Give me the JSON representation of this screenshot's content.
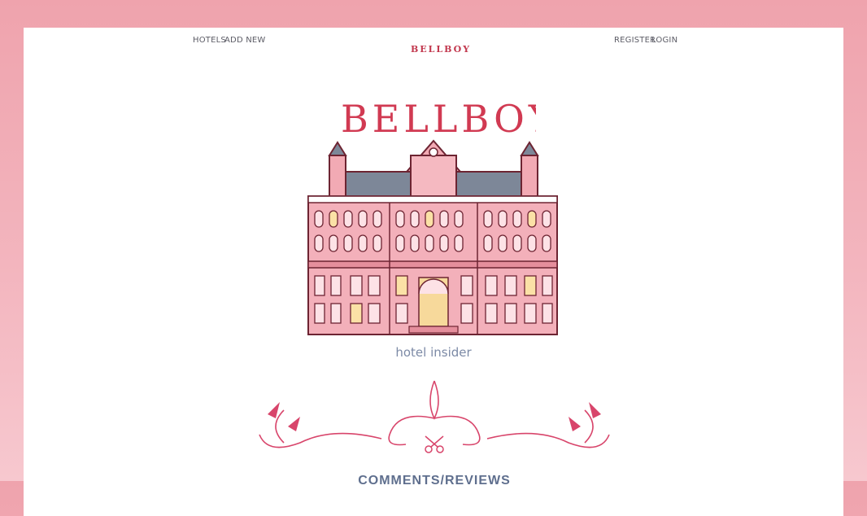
{
  "nav": {
    "hotels": "HOTELS",
    "add_new": "ADD NEW",
    "brand": "BELLBOY",
    "register": "REGISTER",
    "login": "LOGIN"
  },
  "hero": {
    "title": "BELLBOY",
    "tagline": "hotel insider"
  },
  "section": {
    "title": "COMMENTS/REVIEWS"
  },
  "colors": {
    "background": "#efa3ad",
    "brand": "#d13a52",
    "tagline": "#7c8aa6",
    "nav_text": "#5c5c66"
  }
}
